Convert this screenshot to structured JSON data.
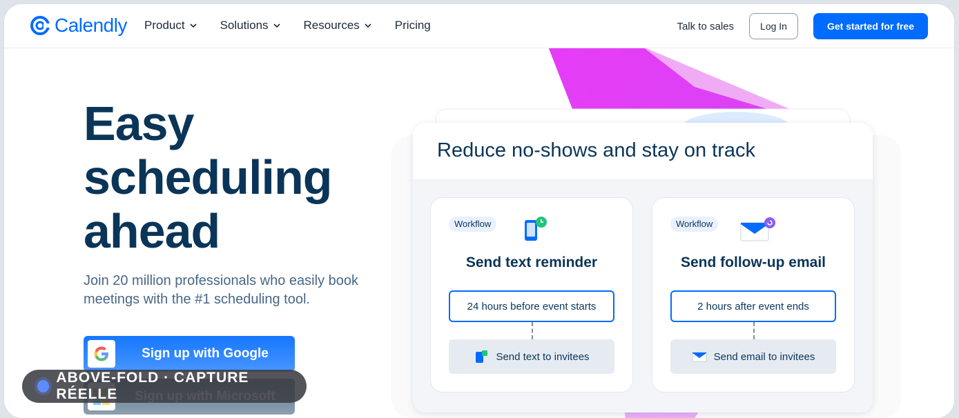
{
  "nav": {
    "logo_text": "Calendly",
    "links": [
      {
        "label": "Product",
        "has_dropdown": true
      },
      {
        "label": "Solutions",
        "has_dropdown": true
      },
      {
        "label": "Resources",
        "has_dropdown": true
      },
      {
        "label": "Pricing",
        "has_dropdown": false
      }
    ],
    "talk_to_sales": "Talk to sales",
    "login": "Log In",
    "cta": "Get started for free"
  },
  "hero": {
    "title_lines": [
      "Easy",
      "scheduling",
      "ahead"
    ],
    "subtitle": "Join 20 million professionals who easily book meetings with the #1 scheduling tool.",
    "google_button": "Sign up with Google",
    "microsoft_button": "Sign up with Microsoft"
  },
  "overlay_badge": "ABOVE-FOLD · CAPTURE RÉELLE",
  "card": {
    "title": "Reduce no-shows and stay on track",
    "workflows": [
      {
        "tag": "Workflow",
        "icon": "phone-clock-icon",
        "title": "Send text reminder",
        "timing": "24 hours before event starts",
        "action": "Send text to invitees",
        "action_icon": "phone-icon"
      },
      {
        "tag": "Workflow",
        "icon": "envelope-refresh-icon",
        "title": "Send follow-up email",
        "timing": "2 hours after event ends",
        "action": "Send email to invitees",
        "action_icon": "envelope-icon"
      }
    ]
  },
  "colors": {
    "brand_blue": "#006bff",
    "navy": "#0b3558",
    "magenta": "#e83ef5",
    "pink_blush": "#f7c8f4",
    "green_clock": "#1fc57a",
    "purple_refresh": "#8a5cf6"
  }
}
